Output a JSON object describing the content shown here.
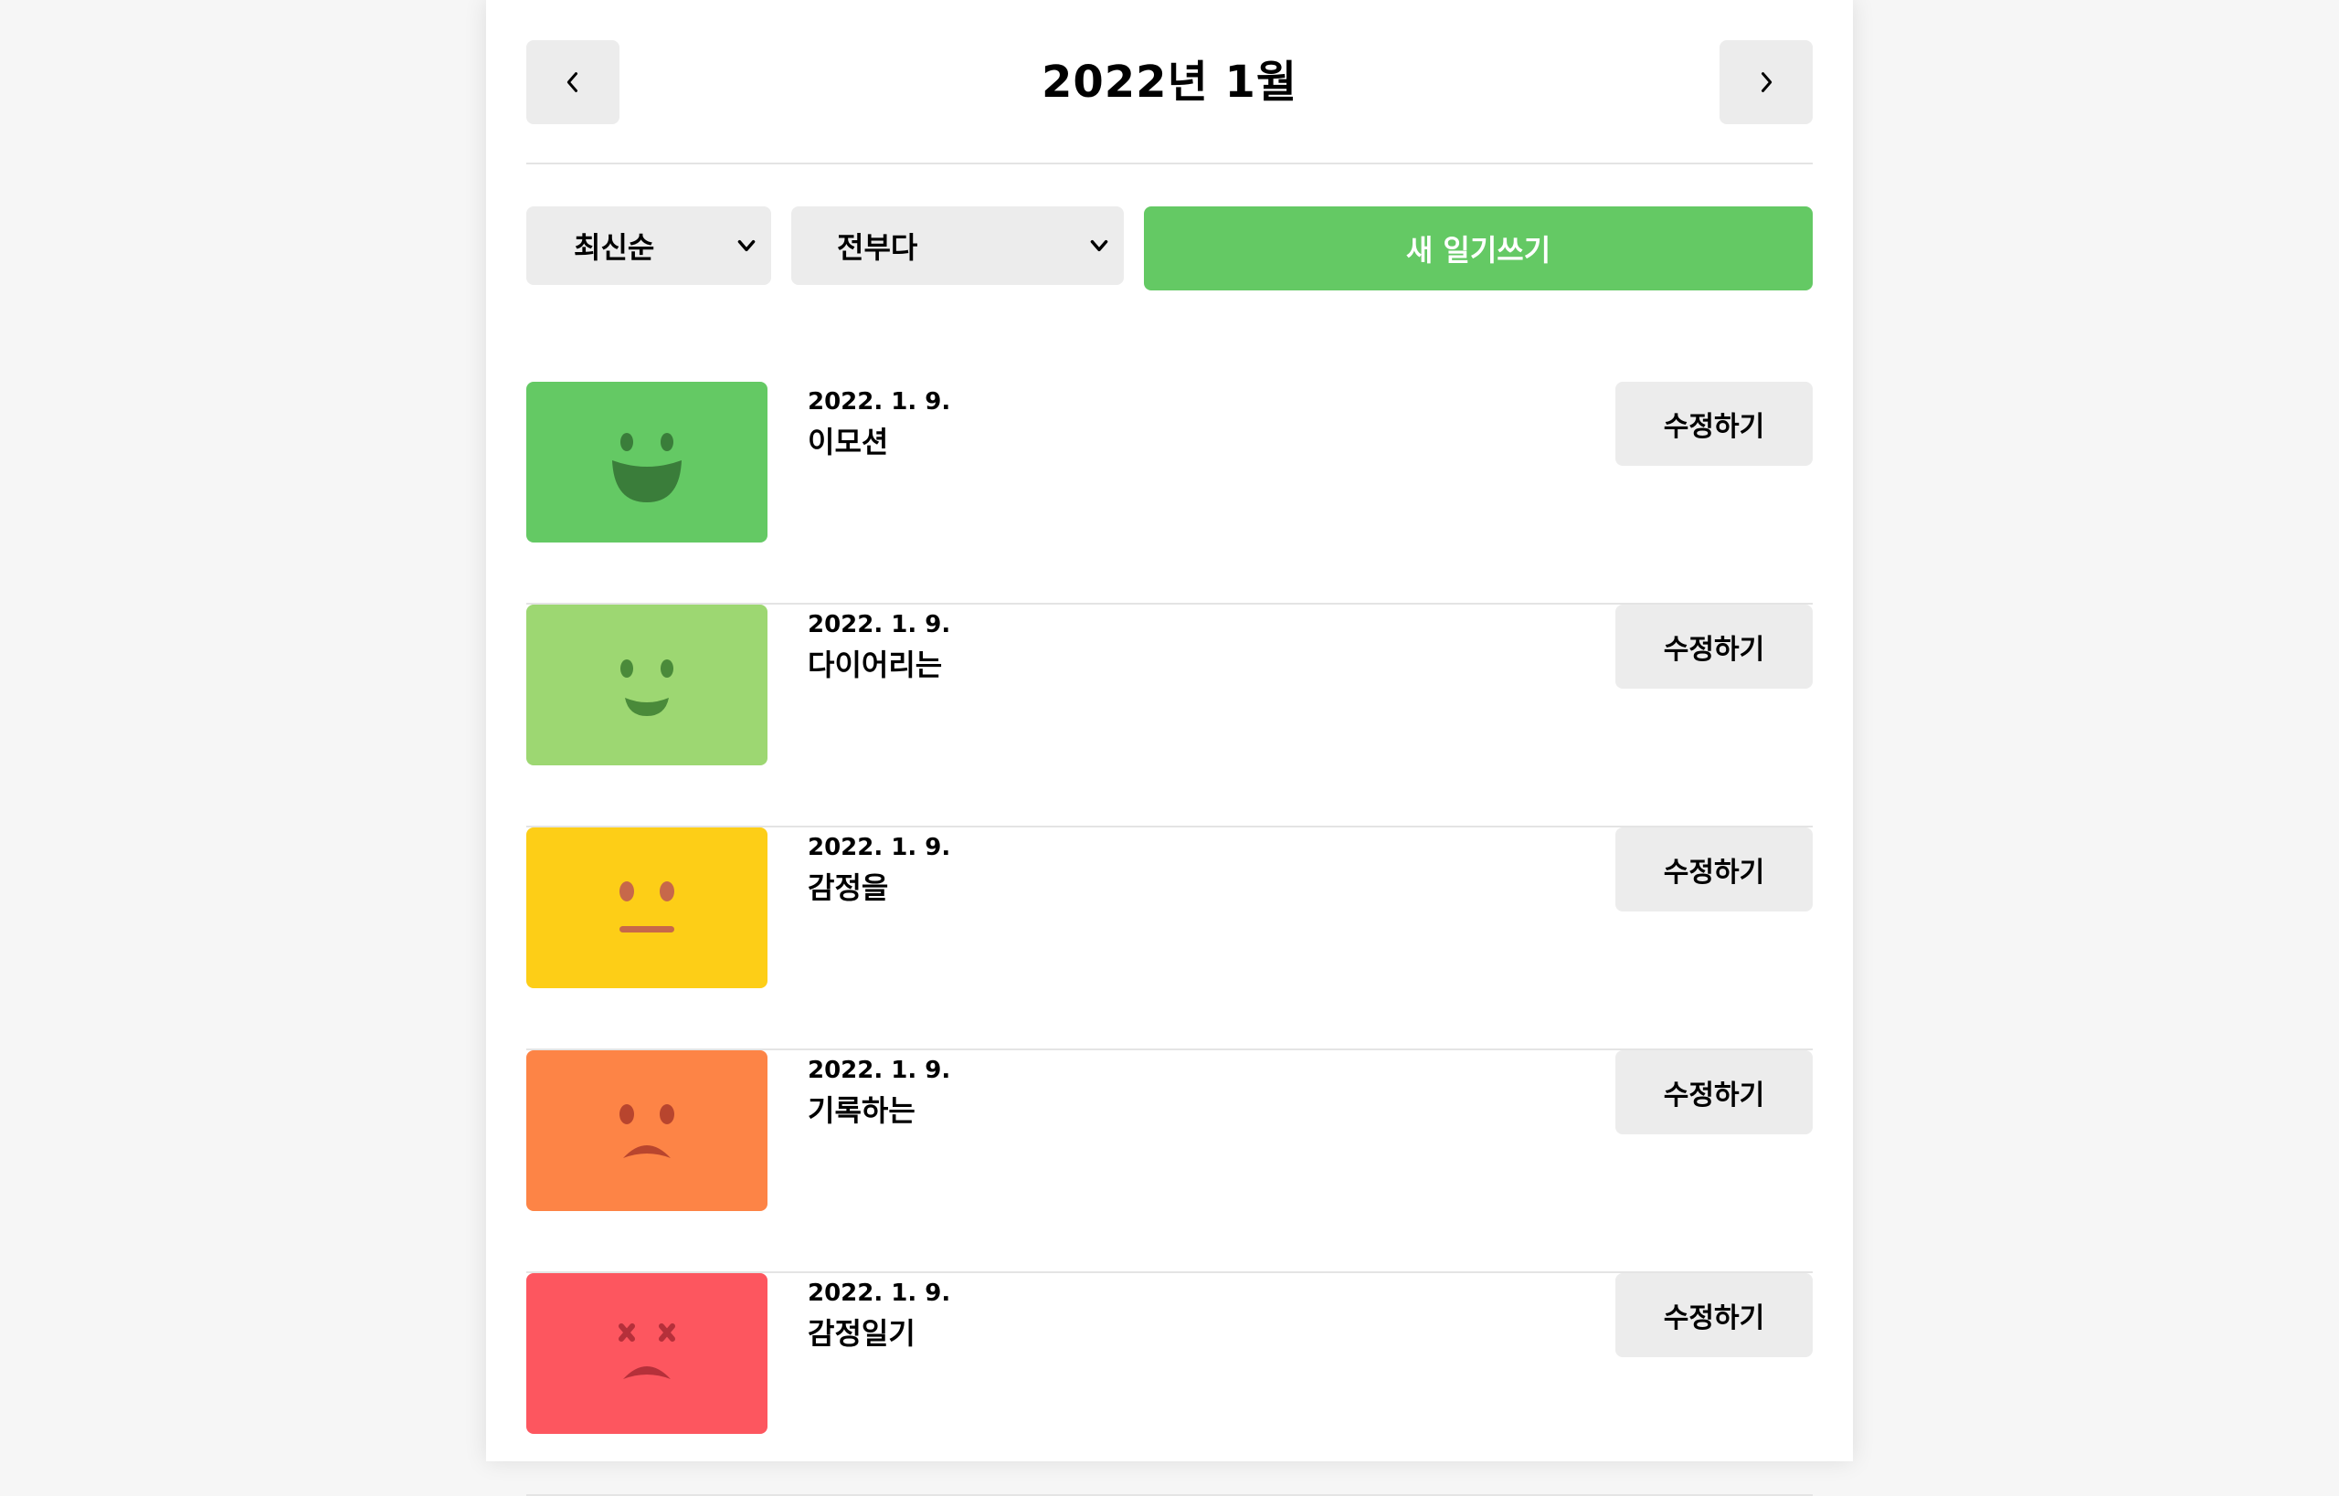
{
  "header": {
    "title": "2022년 1월",
    "prev_icon": "chevron-left-icon",
    "next_icon": "chevron-right-icon"
  },
  "menu": {
    "sort_selected": "최신순",
    "filter_selected": "전부다",
    "new_button_label": "새 일기쓰기",
    "new_button_color": "#64c964"
  },
  "diary_list": [
    {
      "date": "2022. 1. 9.",
      "content": "이모션",
      "emotion_icon": "laughing-face-icon",
      "color": "#64c964",
      "edit_label": "수정하기"
    },
    {
      "date": "2022. 1. 9.",
      "content": "다이어리는",
      "emotion_icon": "smiling-face-icon",
      "color": "#9dd772",
      "edit_label": "수정하기"
    },
    {
      "date": "2022. 1. 9.",
      "content": "감정을",
      "emotion_icon": "neutral-face-icon",
      "color": "#fdce17",
      "edit_label": "수정하기"
    },
    {
      "date": "2022. 1. 9.",
      "content": "기록하는",
      "emotion_icon": "sad-face-icon",
      "color": "#fd8446",
      "edit_label": "수정하기"
    },
    {
      "date": "2022. 1. 9.",
      "content": "감정일기",
      "emotion_icon": "angry-face-icon",
      "color": "#fd565f",
      "edit_label": "수정하기"
    }
  ]
}
